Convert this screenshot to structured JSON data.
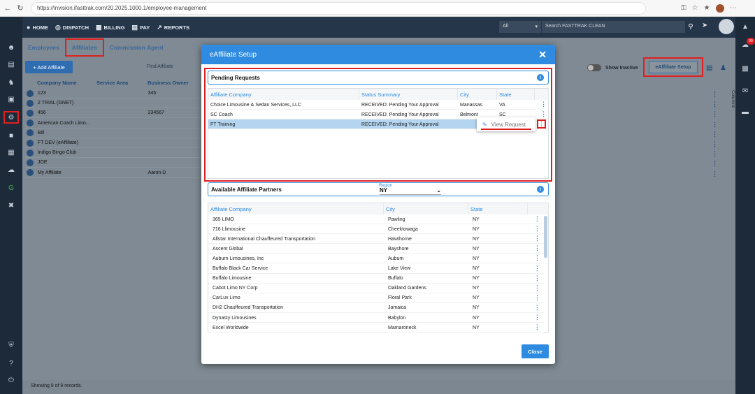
{
  "browser": {
    "url": "https://invision.ifasttrak.com/20.2025.1000.1/employee-management"
  },
  "topnav": {
    "items": [
      {
        "label": "HOME",
        "icon": "home-icon"
      },
      {
        "label": "DISPATCH",
        "icon": "dispatch-icon"
      },
      {
        "label": "BILLING",
        "icon": "billing-icon"
      },
      {
        "label": "PAY",
        "icon": "pay-icon"
      },
      {
        "label": "REPORTS",
        "icon": "reports-icon"
      }
    ],
    "search_scope": "All",
    "search_placeholder": "Search FASTTRAK CLEAN",
    "notification_count": "99"
  },
  "tabs": [
    "Employees",
    "Affiliates",
    "Commission Agent"
  ],
  "page": {
    "add_affiliate": "+ Add Affiliate",
    "find_affiliate": "Find Affiliate",
    "columns": [
      "Company Name",
      "Service Area",
      "Business Owner"
    ],
    "rows": [
      {
        "name": "123",
        "service_area": "",
        "owner": "345"
      },
      {
        "name": "2 TRIAL (GNET)",
        "service_area": "",
        "owner": ""
      },
      {
        "name": "456",
        "service_area": "",
        "owner": "234567"
      },
      {
        "name": "American Coach Limo...",
        "service_area": "",
        "owner": ""
      },
      {
        "name": "Bill",
        "service_area": "",
        "owner": ""
      },
      {
        "name": "FT DEV (eAffiliate)",
        "service_area": "",
        "owner": ""
      },
      {
        "name": "Indigo Bingo Club",
        "service_area": "",
        "owner": ""
      },
      {
        "name": "JOE",
        "service_area": "",
        "owner": ""
      },
      {
        "name": "My Affiliate",
        "service_area": "",
        "owner": "Aaron D"
      }
    ],
    "show_inactive": "Show Inactive",
    "eaffiliate_setup": "eAffiliate Setup",
    "columns_panel": "Columns",
    "footer": "Showing 9 of 9 records."
  },
  "modal": {
    "title": "eAffiliate Setup",
    "pending": {
      "title": "Pending Requests",
      "columns": [
        "Affiliate Company",
        "Status Summary",
        "City",
        "State"
      ],
      "rows": [
        {
          "company": "Choice Limousine & Sedan Services, LLC",
          "status": "RECEIVED: Pending Your Approval",
          "city": "Manassas",
          "state": "VA"
        },
        {
          "company": "SC Coach",
          "status": "RECEIVED: Pending Your Approval",
          "city": "Belmont",
          "state": "SC"
        },
        {
          "company": "FT Training",
          "status": "RECEIVED: Pending Your Approval",
          "city": "",
          "state": ""
        }
      ],
      "menu_item": "View Request"
    },
    "available": {
      "title": "Available Affiliate Partners",
      "region_label": "Region",
      "region_value": "NY",
      "columns": [
        "Affiliate Company",
        "City",
        "State"
      ],
      "rows": [
        {
          "company": "365 LIMO",
          "city": "Pawling",
          "state": "NY"
        },
        {
          "company": "716 Llimousine",
          "city": "Cheektowaga",
          "state": "NY"
        },
        {
          "company": "Allstar International Chauffeured Transportation",
          "city": "Hawthorne",
          "state": "NY"
        },
        {
          "company": "Ascent Global",
          "city": "Bayshore",
          "state": "NY"
        },
        {
          "company": "Auburn Limousines, Inc",
          "city": "Auburn",
          "state": "NY"
        },
        {
          "company": "Buffalo Black Car Service",
          "city": "Lake View",
          "state": "NY"
        },
        {
          "company": "Buffalo Limousine",
          "city": "Buffalo",
          "state": "NY"
        },
        {
          "company": "Cabot Limo NY Corp",
          "city": "Oakland Gardens",
          "state": "NY"
        },
        {
          "company": "CarLux Limo",
          "city": "Floral Park",
          "state": "NY"
        },
        {
          "company": "DH2 Chauffeured Transportation",
          "city": "Jamaica",
          "state": "NY"
        },
        {
          "company": "Dynasty Limousines",
          "city": "Babylon",
          "state": "NY"
        },
        {
          "company": "Excel Worldwide",
          "city": "Mamaroneck",
          "state": "NY"
        }
      ]
    },
    "close": "Close"
  }
}
